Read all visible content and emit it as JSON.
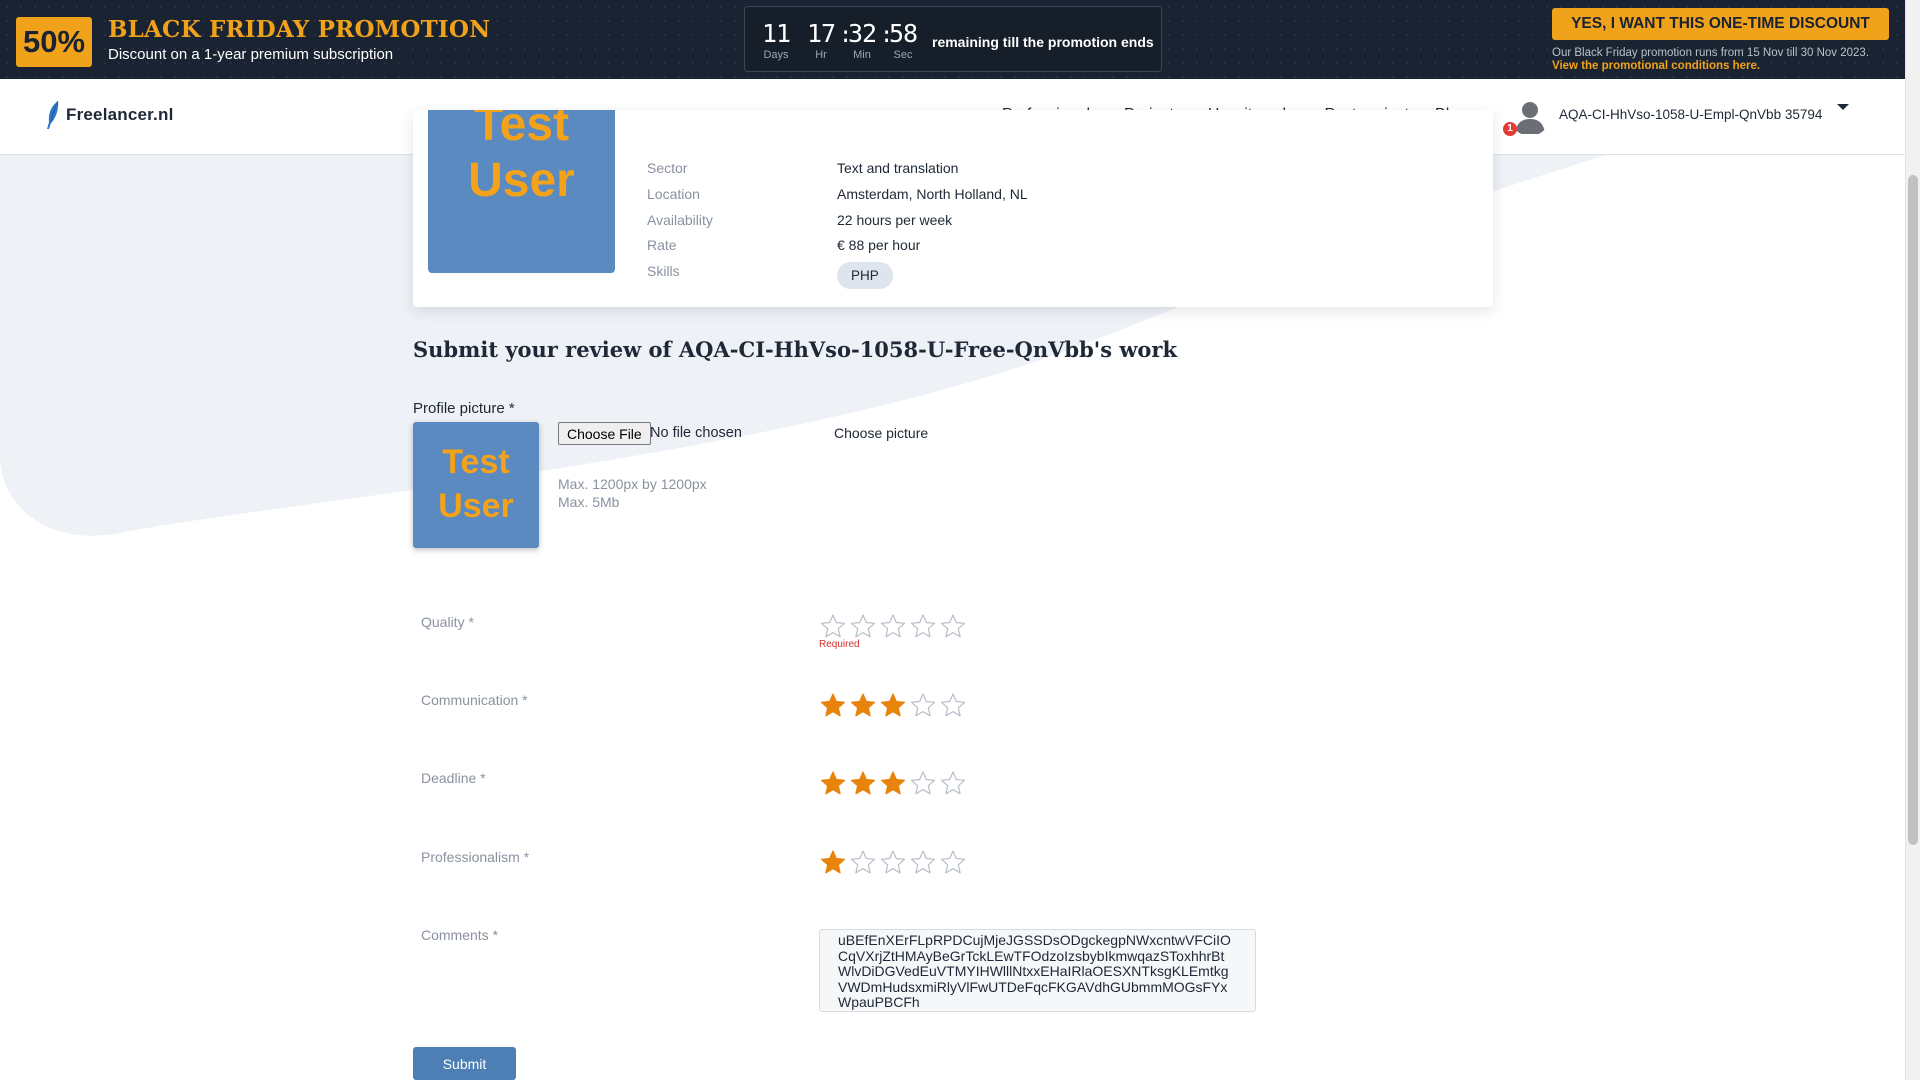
{
  "promo": {
    "badge": "50%",
    "title": "BLACK FRIDAY PROMOTION",
    "subtitle": "Discount on a 1-year premium subscription",
    "countdown": {
      "days": "11",
      "hours": "17",
      "minutes": "32",
      "seconds": "58",
      "days_label": "Days",
      "hours_label": "Hr",
      "minutes_label": "Min",
      "seconds_label": "Sec",
      "text": "remaining till the promotion ends"
    },
    "cta": "YES, I WANT THIS ONE-TIME DISCOUNT",
    "note": "Our Black Friday promotion runs from 15 Nov till 30 Nov 2023.",
    "link": "View the promotional conditions here."
  },
  "header": {
    "logo": "Freelancer.nl",
    "nav": [
      "Professionals",
      "Projects",
      "How it works",
      "Post project",
      "Blog"
    ],
    "notification_count": "1",
    "username": "AQA-CI-HhVso-1058-U-Empl-QnVbb 35794"
  },
  "profile": {
    "picture_text": "Test\nUser",
    "rows": [
      {
        "label": "Sector",
        "value": "Text and translation"
      },
      {
        "label": "Location",
        "value": "Amsterdam, North Holland, NL"
      },
      {
        "label": "Availability",
        "value": "22 hours per week"
      },
      {
        "label": "Rate",
        "value": "€ 88 per hour"
      },
      {
        "label": "Skills",
        "value": ""
      }
    ],
    "skills": [
      "PHP"
    ]
  },
  "review": {
    "title": "Submit your review of AQA-CI-HhVso-1058-U-Free-QnVbb's work",
    "profile_picture_label": "Profile picture *",
    "choose_file_button": "Choose File",
    "no_file_text": "No file chosen",
    "choose_picture": "Choose picture",
    "max_dimensions": "Max. 1200px by 1200px",
    "max_size": "Max. 5Mb",
    "ratings": [
      {
        "label": "Quality *",
        "value": 0
      },
      {
        "label": "Communication *",
        "value": 3
      },
      {
        "label": "Deadline *",
        "value": 3
      },
      {
        "label": "Professionalism *",
        "value": 1
      }
    ],
    "ratings_max": 5,
    "required_text": "Required",
    "comments_label": "Comments *",
    "comments_value": "uBEfEnXErFLpRPDCujMjeJGSSDsODgckegpNWxcntwVFCiIOCqVXrjZtHMAyBeGrTckLEwTFOdzoIzsbybIkmwqazSToxhhrBtWlvDiDGVedEuVTMYIHWlllNtxxEHaIRlaOESXNTksgKLEmtkgVWDmHudsxmiRlyVlFwUTDeFqcFKGAVdhGUbmmMOGsFYxWpauPBCFh",
    "submit": "Submit"
  },
  "colors": {
    "accent": "#f0a21b",
    "promo_bg": "#1a2331",
    "star_filled": "#e8830c",
    "submit_bg": "#4d7fb5"
  }
}
